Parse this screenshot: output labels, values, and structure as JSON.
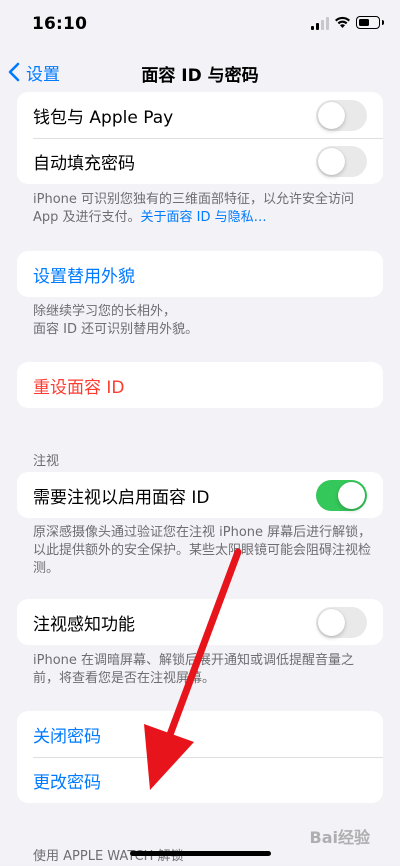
{
  "status_bar": {
    "time": "16:10"
  },
  "nav": {
    "back_label": "设置",
    "title": "面容 ID 与密码"
  },
  "top_group": {
    "items": [
      {
        "label": "钱包与 Apple Pay",
        "toggle": "off"
      },
      {
        "label": "自动填充密码",
        "toggle": "off"
      }
    ],
    "footnote": "iPhone 可识别您独有的三维面部特征，以允许安全访问 App 及进行支付。",
    "footnote_link": "关于面容 ID 与隐私…"
  },
  "alternate_appearance": {
    "button_label": "设置替用外貌",
    "footnote_line1": "除继续学习您的长相外，",
    "footnote_line2": "面容 ID 还可识别替用外貌。"
  },
  "reset": {
    "button_label": "重设面容 ID"
  },
  "attention": {
    "section_header": "注视",
    "require_label": "需要注视以启用面容 ID",
    "require_toggle": "on",
    "require_footnote": "原深感摄像头通过验证您在注视 iPhone 屏幕后进行解锁，以此提供额外的安全保护。某些太阳眼镜可能会阻碍注视检测。",
    "aware_label": "注视感知功能",
    "aware_toggle": "off",
    "aware_footnote": "iPhone 在调暗屏幕、解锁后展开通知或调低提醒音量之前，将查看您是否在注视屏幕。"
  },
  "passcode": {
    "turn_off_label": "关闭密码",
    "change_label": "更改密码"
  },
  "apple_watch": {
    "section_header": "使用 APPLE WATCH 解锁"
  },
  "watermark": "Bai经验",
  "colors": {
    "accent": "#007aff",
    "danger": "#ff3b30",
    "switch_on": "#34c759",
    "annotation_arrow": "#e8141b"
  }
}
